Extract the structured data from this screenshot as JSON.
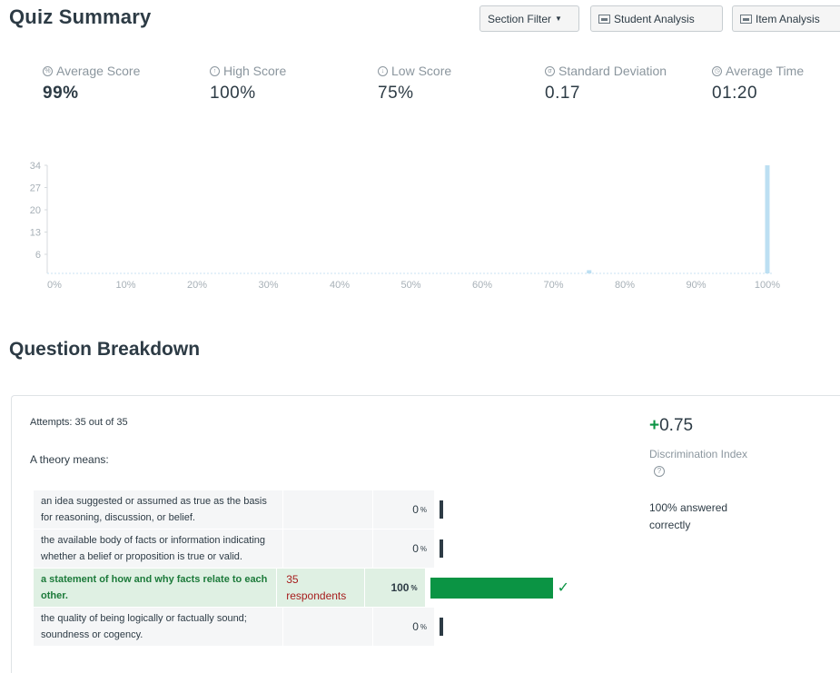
{
  "header": {
    "title": "Quiz Summary",
    "section_filter": "Section Filter",
    "student_analysis": "Student Analysis",
    "item_analysis": "Item Analysis"
  },
  "stats": [
    {
      "label": "Average Score",
      "value": "99%",
      "icon": "percent-circle-icon"
    },
    {
      "label": "High Score",
      "value": "100%",
      "icon": "arrow-up-circle-icon"
    },
    {
      "label": "Low Score",
      "value": "75%",
      "icon": "arrow-down-circle-icon"
    },
    {
      "label": "Standard Deviation",
      "value": "0.17",
      "icon": "sigma-circle-icon"
    },
    {
      "label": "Average Time",
      "value": "01:20",
      "icon": "clock-icon"
    }
  ],
  "chart_data": {
    "type": "bar",
    "categories": [
      "0%",
      "10%",
      "20%",
      "30%",
      "40%",
      "50%",
      "60%",
      "70%",
      "75%",
      "80%",
      "90%",
      "100%"
    ],
    "values": [
      0,
      0,
      0,
      0,
      0,
      0,
      0,
      0,
      1,
      0,
      0,
      34
    ],
    "y_ticks": [
      "34",
      "27",
      "20",
      "13",
      "6"
    ],
    "x_ticks": [
      "0%",
      "10%",
      "20%",
      "30%",
      "40%",
      "50%",
      "60%",
      "70%",
      "80%",
      "90%",
      "100%"
    ],
    "ylim": [
      0,
      34
    ],
    "bar_color": "#bcdff2"
  },
  "breakdown": {
    "title": "Question Breakdown",
    "attempts": "Attempts: 35 out of 35",
    "question": "A theory  means:",
    "answers": [
      {
        "text": "an idea suggested or assumed as true as the basis for reasoning, discussion, or belief.",
        "respondents": "",
        "percent": "0",
        "percent_sign": "%",
        "fraction": 0,
        "correct": false
      },
      {
        "text": "the available body of facts or information indicating whether a belief or proposition is true or valid.",
        "respondents": "",
        "percent": "0",
        "percent_sign": "%",
        "fraction": 0,
        "correct": false
      },
      {
        "text": "a statement of how and why facts relate to each other.",
        "respondents": "35 respondents",
        "percent": "100",
        "percent_sign": "%",
        "fraction": 1,
        "correct": true
      },
      {
        "text": "the quality of being logically or factually sound; soundness or cogency.",
        "respondents": "",
        "percent": "0",
        "percent_sign": "%",
        "fraction": 0,
        "correct": false
      }
    ],
    "discrimination_sign": "+",
    "discrimination_value": "0.75",
    "discrimination_label": "Discrimination Index",
    "answered_text": "100% answered correctly",
    "accent_color": "#0b9444"
  }
}
